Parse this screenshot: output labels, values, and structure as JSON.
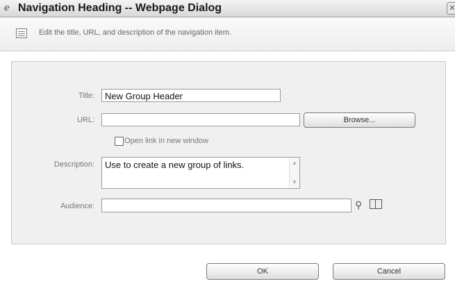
{
  "window": {
    "title": "Navigation Heading -- Webpage Dialog"
  },
  "description": "Edit the title, URL, and description of the navigation item.",
  "form": {
    "title_label": "Title:",
    "title_value": "New Group Header",
    "url_label": "URL:",
    "url_value": "",
    "browse_label": "Browse...",
    "open_new_window_label": "Open link in new window",
    "open_new_window_checked": false,
    "description_label": "Description:",
    "description_value": "Use to create a new group of links.",
    "audience_label": "Audience:",
    "audience_value": ""
  },
  "buttons": {
    "ok": "OK",
    "cancel": "Cancel"
  },
  "icons": {
    "titlebar": "ie-page-icon",
    "description": "list-page-icon",
    "people_picker": "people-picker-icon",
    "address_book": "address-book-icon"
  }
}
